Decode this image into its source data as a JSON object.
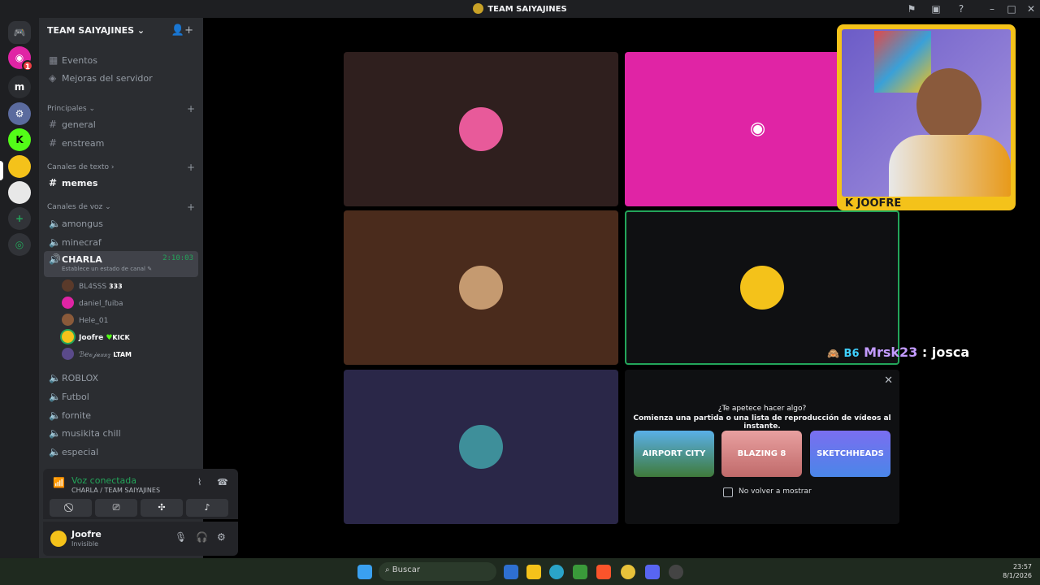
{
  "window": {
    "title": "TEAM SAIYAJINES"
  },
  "rail": {
    "home_badge": "1",
    "server_initial": "m"
  },
  "sidebar": {
    "server_name": "TEAM SAIYAJINES",
    "top_items": [
      "Eventos",
      "Mejoras del servidor"
    ],
    "categories": {
      "principales": "Principales",
      "texto": "Canales de texto",
      "voz": "Canales de voz"
    },
    "principales_channels": [
      "general",
      "enstream"
    ],
    "text_channels": [
      "memes"
    ],
    "voice_channels_before": [
      "amongus",
      "minecraf"
    ],
    "active_voice": {
      "name": "CHARLA",
      "timer": "2:10:03",
      "status": "Establece un estado de canal"
    },
    "participants": [
      {
        "name": "BL4SSS",
        "tag": "333"
      },
      {
        "name": "daniel_fuiba",
        "tag": ""
      },
      {
        "name": "Hele_01",
        "tag": ""
      },
      {
        "name": "Joofre",
        "tag": "KICK"
      },
      {
        "name": "ℬℯ𝓋𝒿𝒶𝓍𝓍𝓏",
        "tag": "LTAM"
      }
    ],
    "voice_channels_after": [
      "ROBLOX",
      "Futbol",
      "fornite",
      "musikita chill",
      "especial"
    ]
  },
  "voice_panel": {
    "status": "Voz conectada",
    "location": "CHARLA / TEAM SAIYAJINES"
  },
  "user_panel": {
    "name": "Joofre",
    "status": "Invisible"
  },
  "stream": {
    "pip_label": "K JOOFRE",
    "chat_user": "Mrsk23",
    "chat_message": ": josca",
    "chat_badge": "B6"
  },
  "activity": {
    "title": "¿Te apetece hacer algo?",
    "subtitle": "Comienza una partida o una lista de reproducción de vídeos al instante.",
    "games": [
      "AIRPORT CITY",
      "BLAZING 8",
      "SKETCHHEADS"
    ],
    "checkbox_label": "No volver a mostrar"
  },
  "taskbar": {
    "search_placeholder": "Buscar",
    "time": "23:57",
    "date": "8/1/2026"
  },
  "colors": {
    "accent": "#5865f2",
    "online": "#23a55a",
    "pip_border": "#f4c21a",
    "chat_name": "#c39bff"
  }
}
